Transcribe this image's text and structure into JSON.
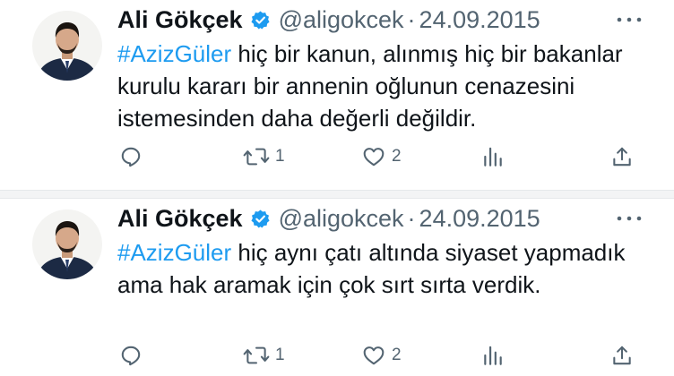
{
  "tweets": [
    {
      "author": {
        "name": "Ali Gökçek",
        "handle": "@aligokcek",
        "separator": "·",
        "date": "24.09.2015",
        "verified": true
      },
      "hashtag": "#AzizGüler",
      "text": " hiç bir kanun, alınmış hiç bir bakanlar kurulu kararı bir annenin oğlunun cenazesini istemesinden daha değerli değildir.",
      "actions": {
        "reply_count": "",
        "retweet_count": "1",
        "like_count": "2",
        "views_count": ""
      }
    },
    {
      "author": {
        "name": "Ali Gökçek",
        "handle": "@aligokcek",
        "separator": "·",
        "date": "24.09.2015",
        "verified": true
      },
      "hashtag": "#AzizGüler",
      "text": " hiç aynı çatı altında siyaset yapmadık ama hak aramak için çok sırt sırta verdik.",
      "actions": {
        "reply_count": "",
        "retweet_count": "1",
        "like_count": "2",
        "views_count": ""
      }
    }
  ],
  "icons": {
    "verified": "verified-badge-icon",
    "more": "more-options-icon",
    "reply": "reply-icon",
    "retweet": "retweet-icon",
    "like": "heart-icon",
    "views": "views-icon",
    "share": "share-icon"
  },
  "colors": {
    "link": "#1d9bf0",
    "secondary_text": "#536471",
    "primary_text": "#0f1419",
    "verified": "#1d9bf0",
    "divider": "#f3f4f5"
  }
}
